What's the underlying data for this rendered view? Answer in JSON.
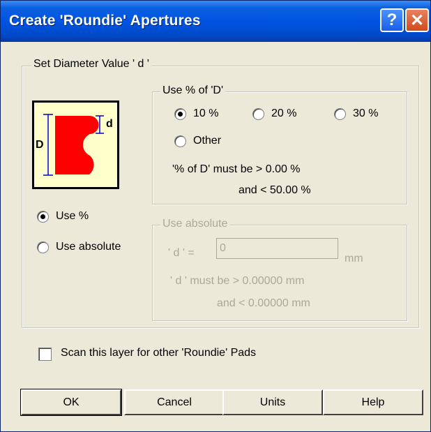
{
  "window": {
    "title": "Create 'Roundie' Apertures",
    "help_glyph": "?",
    "close_glyph": "✕"
  },
  "diameter_group": {
    "label": "Set Diameter Value ' d '"
  },
  "illustration": {
    "label_D": "D",
    "label_d": "d",
    "shape_color": "#ff0000",
    "bg_color": "#ffffcc"
  },
  "mode": {
    "use_percent": "Use %",
    "use_absolute": "Use absolute",
    "selected": "use_percent"
  },
  "percent_group": {
    "label": "Use % of 'D'",
    "options": [
      "10 %",
      "20 %",
      "30 %",
      "Other"
    ],
    "selected": "10 %",
    "constraint_line1": "'% of D' must be  >  0.00 %",
    "constraint_line2": "and  <  50.00 %"
  },
  "absolute_group": {
    "label": "Use absolute",
    "field_label": "' d ' =",
    "field_value": "0",
    "unit": "mm",
    "constraint_line1": "' d ' must be  >  0.00000 mm",
    "constraint_line2": "and  <  0.00000 mm"
  },
  "scan_checkbox": {
    "label": "Scan this layer for other 'Roundie' Pads",
    "checked": false
  },
  "buttons": {
    "ok": "OK",
    "cancel": "Cancel",
    "units": "Units",
    "help": "Help"
  }
}
